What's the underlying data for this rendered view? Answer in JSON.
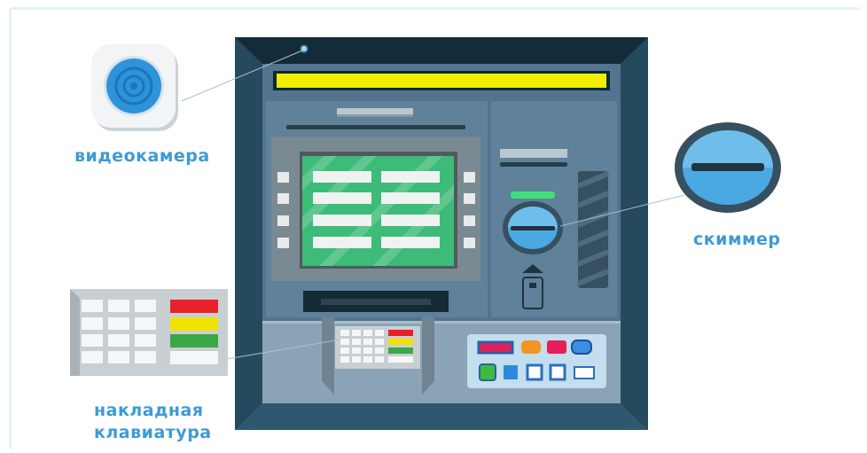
{
  "labels": {
    "camera": "видеокамера",
    "skimmer": "скиммер",
    "keypad_line1": "накладная",
    "keypad_line2": "клавиатура"
  },
  "colors": {
    "label_text": "#3d9bd4",
    "atm_frame_dark": "#1d3a4a",
    "atm_body": "#5a7e9b",
    "screen_green": "#3dbb78",
    "yellow_strip": "#f1ee00",
    "skimmer_blue": "#4aa8e2"
  },
  "icons": {
    "camera": "camera-lens-icon",
    "skimmer": "card-slot-skimmer-icon",
    "keypad": "overlay-keypad-icon",
    "card": "card-insert-icon"
  }
}
